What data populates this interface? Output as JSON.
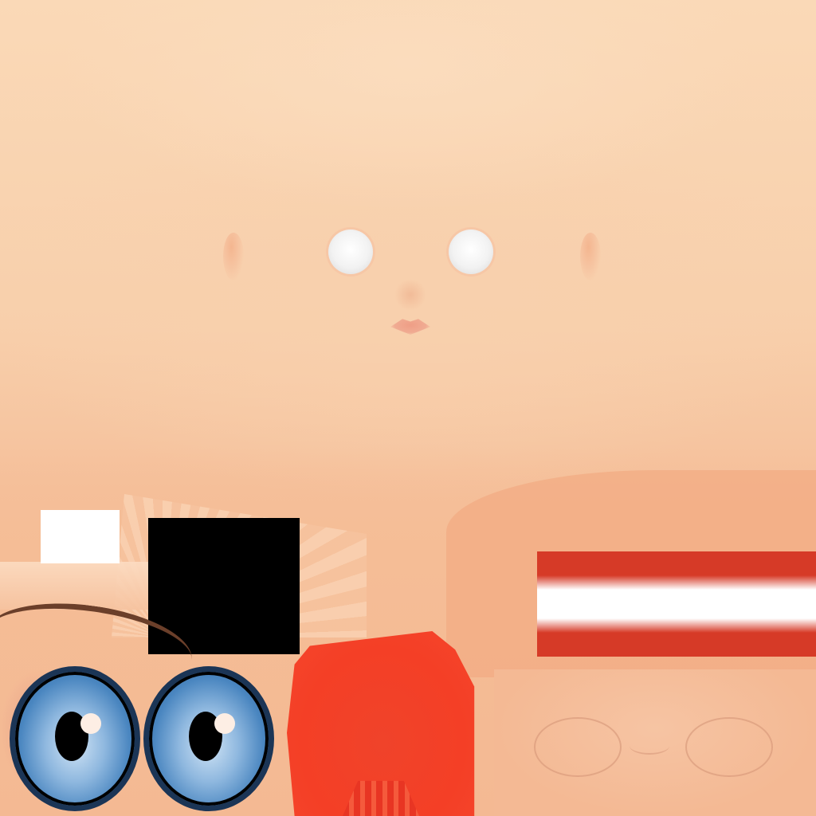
{
  "texture": {
    "regions": [
      "skin-base",
      "face-features",
      "left-eyeball",
      "right-eyeball",
      "red-white-red-band",
      "red-shape",
      "lower-face"
    ],
    "colors": {
      "skin": "#f8cfab",
      "skin_shadow": "#f3b58d",
      "white_block": "#ffffff",
      "black_block": "#000000",
      "flag_red": "#d63a27",
      "flag_white": "#ffffff",
      "iris_blue": "#4a86c0",
      "iris_rim": "#1b3556",
      "eyebrow": "#6b3f2a",
      "red_shape": "#f43f26"
    },
    "icons": [
      "eye-icon",
      "eyebrow-icon"
    ]
  }
}
